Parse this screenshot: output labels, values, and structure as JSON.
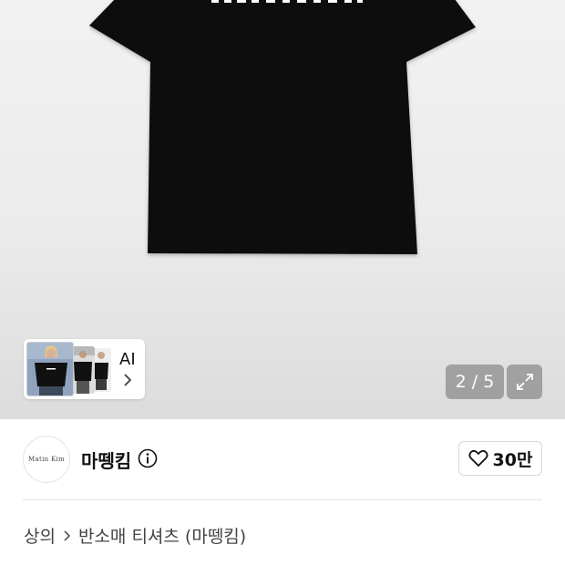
{
  "gallery": {
    "counter": "2 / 5",
    "ai_label": "AI",
    "icons": {
      "expand": "expand-icon",
      "ai_chevron": "chevron-right-icon"
    }
  },
  "brand": {
    "logo_text": "Matin Kim",
    "name": "마뗑킴",
    "info_icon": "info-icon",
    "like_icon": "heart-outline-icon",
    "like_count": "30만"
  },
  "breadcrumb": {
    "items": [
      "상의",
      "반소매 티셔츠 (마뗑킴)"
    ],
    "separator_icon": "chevron-right-icon"
  },
  "colors": {
    "shirt": "#0c0c0c",
    "counter_bg": "#8a8a8a",
    "text": "#111111"
  }
}
